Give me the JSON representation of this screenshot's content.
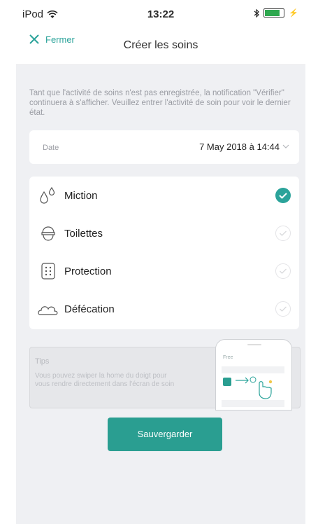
{
  "status_bar": {
    "device": "iPod",
    "time": "13:22"
  },
  "nav": {
    "close_label": "Fermer",
    "title": "Créer les soins"
  },
  "info_text": "Tant que l'activité de soins n'est pas enregistrée, la notification \"Vérifier\" continuera à s'afficher. Veuillez entrer l'activité de soin pour voir le dernier état.",
  "date_field": {
    "label": "Date",
    "value": "7 May 2018 à 14:44"
  },
  "care_items": [
    {
      "label": "Miction",
      "icon": "drops-icon",
      "checked": true
    },
    {
      "label": "Toilettes",
      "icon": "toilet-icon",
      "checked": false
    },
    {
      "label": "Protection",
      "icon": "diaper-icon",
      "checked": false
    },
    {
      "label": "Défécation",
      "icon": "cloud-icon",
      "checked": false
    }
  ],
  "tips": {
    "title": "Tips",
    "text": "Vous pouvez swiper la home du doigt pour vous rendre directement dans l'écran de soin",
    "mini_phone_label": "Free"
  },
  "save_label": "Sauvergarder",
  "colors": {
    "accent": "#2ba39a",
    "button": "#2a9e91",
    "background": "#eff0f3"
  }
}
